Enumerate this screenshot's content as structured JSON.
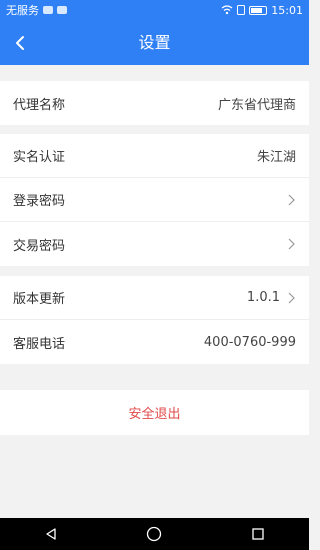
{
  "status": {
    "carrier": "无服务",
    "time": "15:01"
  },
  "header": {
    "title": "设置"
  },
  "rows": [
    {
      "label": "代理名称",
      "value": "广东省代理商"
    },
    {
      "label": "实名认证",
      "value": "朱江湖"
    },
    {
      "label": "登录密码",
      "value": ""
    },
    {
      "label": "交易密码",
      "value": ""
    },
    {
      "label": "版本更新",
      "value": "1.0.1"
    },
    {
      "label": "客服电话",
      "value": "400-0760-999"
    }
  ],
  "logout_label": "安全退出"
}
